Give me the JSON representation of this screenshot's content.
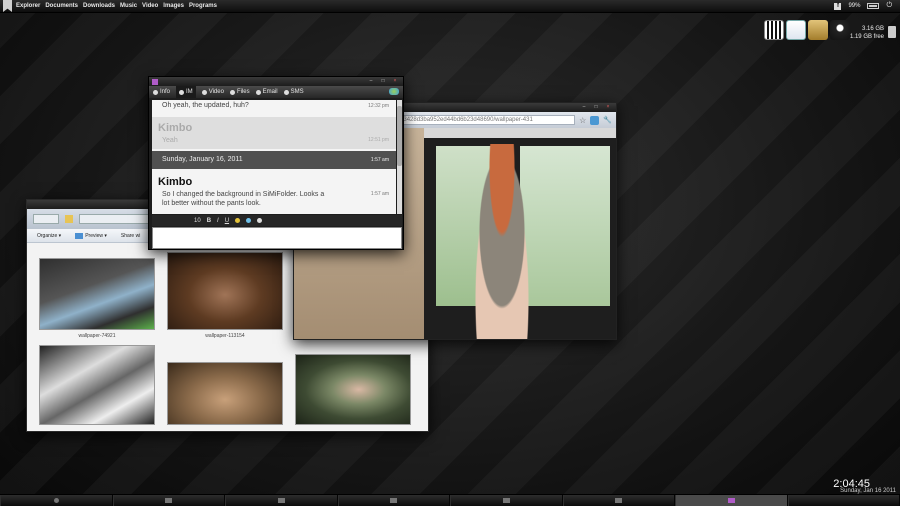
{
  "topbar": {
    "menus": [
      "Explorer",
      "Documents",
      "Downloads",
      "Music",
      "Video",
      "Images",
      "Programs"
    ],
    "battery": "99%"
  },
  "storage": {
    "used": "3.16 GB",
    "free": "1.19 GB free"
  },
  "dock_icons": [
    "dock-app-icon",
    "google-icon",
    "notes-icon",
    "webcam-icon"
  ],
  "explorer": {
    "toolbar": {
      "organize": "Organize ▾",
      "preview": "Preview ▾",
      "share": "Share wi"
    },
    "thumbnails": [
      {
        "label": "wallpaper-74921",
        "colors": [
          "#2f2f2f",
          "#8fb1c9",
          "#5cb14a"
        ]
      },
      {
        "label": "wallpaper-113154",
        "colors": [
          "#5e3b22",
          "#a07457",
          "#2a1a10"
        ]
      },
      {
        "label": "",
        "colors": [
          "#666",
          "#ddd",
          "#222"
        ]
      },
      {
        "label": "",
        "colors": [
          "#8a6a4a",
          "#c8a07a",
          "#3a2a1a"
        ]
      },
      {
        "label": "",
        "colors": [
          "#3e4b33",
          "#7b8866",
          "#1d2418"
        ]
      }
    ]
  },
  "browser": {
    "url": "/77a333428d3ba952ed44bd6b23d48690/wallpaper-431"
  },
  "im": {
    "tabs": [
      "Info",
      "IM",
      "Video",
      "Files",
      "Email",
      "SMS"
    ],
    "messages": [
      {
        "sender": "",
        "text": "Oh yeah, the updated, huh?",
        "time": "12:32 pm"
      },
      {
        "sender": "Kimbo",
        "text": "Yeah",
        "time": "12:51 pm"
      },
      {
        "sender": "",
        "text": "Sunday, January 16, 2011",
        "time": "1:57 am"
      },
      {
        "sender": "Kimbo",
        "text": "So I changed the background in SiMiFolder. Looks a lot better without the pants look.",
        "time": "1:57 am"
      }
    ],
    "format": {
      "size": "10",
      "bold": "B",
      "italic": "I",
      "underline": "U"
    }
  },
  "clock": {
    "time": "2:04:45",
    "date": "Sunday, Jan 16 2011"
  },
  "taskbar_count": 8
}
